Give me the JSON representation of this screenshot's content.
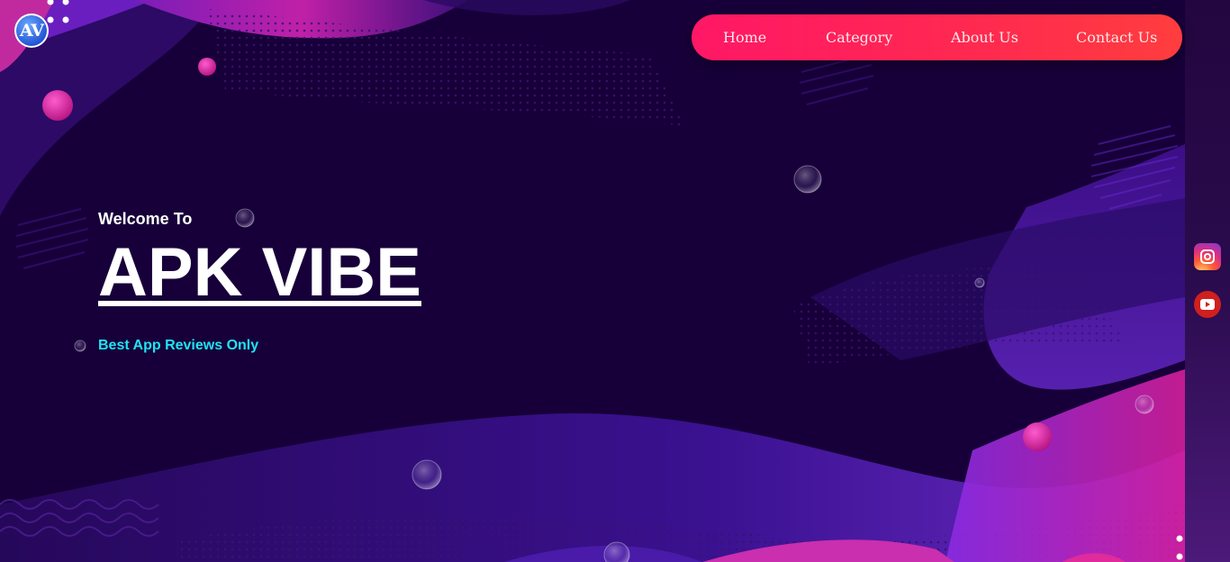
{
  "brand": {
    "logo_text": "AV"
  },
  "nav": {
    "items": [
      {
        "label": "Home"
      },
      {
        "label": "Category"
      },
      {
        "label": "About Us"
      },
      {
        "label": "Contact Us"
      }
    ]
  },
  "hero": {
    "welcome": "Welcome To",
    "title": "APK VIBE",
    "subtitle": "Best App Reviews Only"
  },
  "social": {
    "icons": [
      "instagram-icon",
      "youtube-icon"
    ]
  },
  "colors": {
    "background": "#170039",
    "nav_gradient_start": "#ff1766",
    "nav_gradient_end": "#ff3d3d",
    "subtitle": "#1ee4f5",
    "accent_pink": "#e0289a",
    "accent_purple": "#5b1fb3"
  }
}
